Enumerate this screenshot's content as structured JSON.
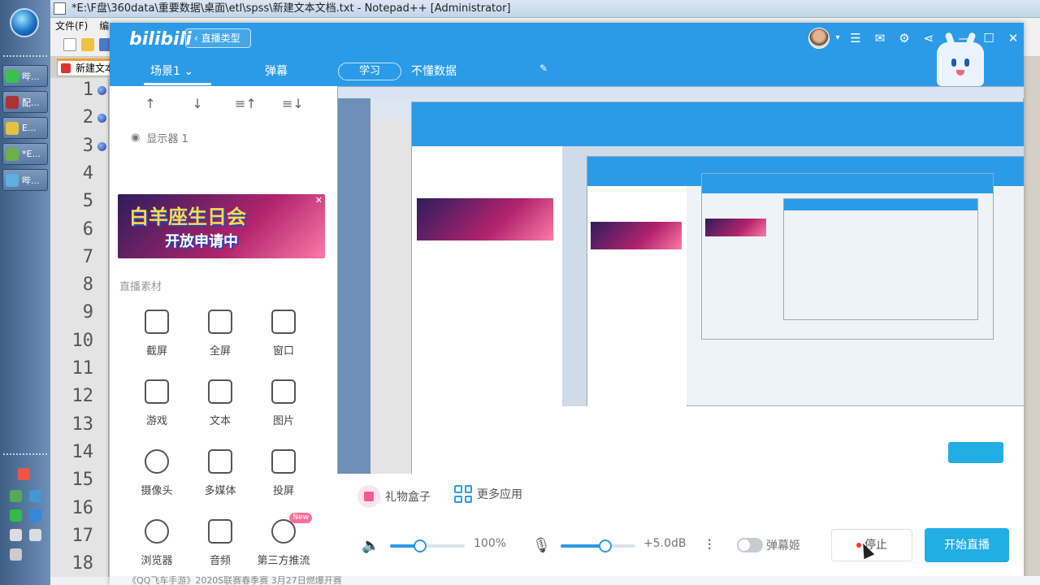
{
  "taskbar": {
    "buttons": [
      "哔...",
      "配...",
      "E...",
      "*E...",
      "哔..."
    ]
  },
  "notepad": {
    "title": "*E:\\F盘\\360data\\重要数据\\桌面\\etl\\spss\\新建文本文档.txt - Notepad++ [Administrator]",
    "menu": [
      "文件(F)",
      "编"
    ],
    "tab": "新建文本",
    "line_numbers": [
      "1",
      "2",
      "3",
      "4",
      "5",
      "6",
      "7",
      "8",
      "9",
      "10",
      "11",
      "12",
      "13",
      "14",
      "15",
      "16",
      "17",
      "18"
    ]
  },
  "app": {
    "logo": "bilibili",
    "back_label": "直播类型",
    "scene_tab": "场景1",
    "danmu_tab": "弹幕",
    "study_tab": "学习",
    "unknown_tab": "不懂数据",
    "arrows": [
      "↑",
      "↓",
      "≡↑",
      "≡↓"
    ],
    "source": "显示器 1",
    "banner": {
      "line1": "白羊座生日会",
      "line2": "开放申请中"
    },
    "materials_title": "直播素材",
    "materials": [
      {
        "label": "截屏",
        "icon": "crop-icon"
      },
      {
        "label": "全屏",
        "icon": "monitor-icon"
      },
      {
        "label": "窗口",
        "icon": "window-icon"
      },
      {
        "label": "游戏",
        "icon": "gamepad-icon"
      },
      {
        "label": "文本",
        "icon": "text-icon"
      },
      {
        "label": "图片",
        "icon": "image-icon"
      },
      {
        "label": "摄像头",
        "icon": "camera-icon"
      },
      {
        "label": "多媒体",
        "icon": "media-icon"
      },
      {
        "label": "投屏",
        "icon": "phone-icon"
      },
      {
        "label": "浏览器",
        "icon": "browser-icon"
      },
      {
        "label": "音频",
        "icon": "music-icon"
      },
      {
        "label": "第三方推流",
        "icon": "stream-icon",
        "badge": "New"
      }
    ],
    "gift_box": "礼物盒子",
    "more_apps": "更多应用",
    "volume": "100%",
    "volume_level": 0.4,
    "mic_gain": "+5.0dB",
    "mic_level": 0.6,
    "danmaku_girl": "弹幕姬",
    "stop": "停止",
    "start_live": "开始直播",
    "status_text": "《QQ飞车手游》2020S联赛春季赛 3月27日燃爆开赛",
    "colors": {
      "brand": "#2b9be8",
      "start": "#23ade5",
      "pink": "#fb7299"
    }
  }
}
